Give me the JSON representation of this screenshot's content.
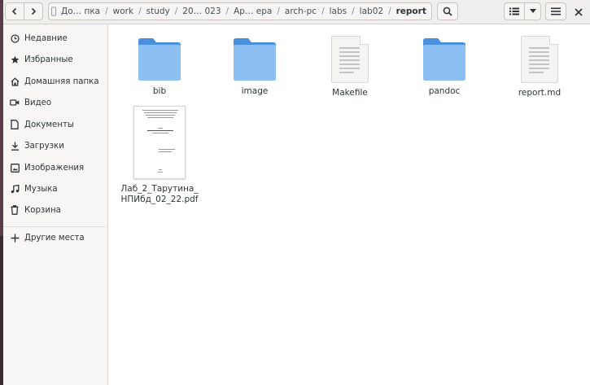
{
  "window": {
    "breadcrumb": [
      {
        "label": "До… пка"
      },
      {
        "label": "work"
      },
      {
        "label": "study"
      },
      {
        "label": "20… 023"
      },
      {
        "label": "Ар… ера"
      },
      {
        "label": "arch-pc"
      },
      {
        "label": "labs"
      },
      {
        "label": "lab02"
      },
      {
        "label": "report"
      }
    ],
    "separator": "/"
  },
  "toolbar": {
    "icons": {
      "back": "chevron-left-icon",
      "forward": "chevron-right-icon",
      "home": "home-icon",
      "path_menu": "more-vertical-icon",
      "search": "search-icon",
      "view": "list-view-icon",
      "view_drop": "caret-down-icon",
      "menu": "hamburger-icon",
      "close": "close-icon"
    }
  },
  "sidebar": {
    "items": [
      {
        "label": "Недавние",
        "icon": "clock-icon"
      },
      {
        "label": "Избранные",
        "icon": "star-icon"
      },
      {
        "label": "Домашняя папка",
        "icon": "home-icon"
      },
      {
        "label": "Видео",
        "icon": "camera-icon"
      },
      {
        "label": "Документы",
        "icon": "document-icon"
      },
      {
        "label": "Загрузки",
        "icon": "download-icon"
      },
      {
        "label": "Изображения",
        "icon": "image-icon"
      },
      {
        "label": "Музыка",
        "icon": "music-icon"
      },
      {
        "label": "Корзина",
        "icon": "trash-icon"
      }
    ],
    "other_places": {
      "label": "Другие места",
      "icon": "plus-icon"
    }
  },
  "files": [
    {
      "name": "bib",
      "kind": "folder"
    },
    {
      "name": "image",
      "kind": "folder"
    },
    {
      "name": "Makefile",
      "kind": "text"
    },
    {
      "name": "pandoc",
      "kind": "folder"
    },
    {
      "name": "report.md",
      "kind": "text"
    },
    {
      "name_line1": "Лаб_2_Тарутина_",
      "name_line2": "НПИбд_02_22.pdf",
      "kind": "pdf"
    }
  ],
  "colors": {
    "folder": "#5fa2e6",
    "folder_light": "#8cc0f2",
    "header_bg": "#f0efed",
    "sidebar_bg": "#f7f6f5"
  }
}
